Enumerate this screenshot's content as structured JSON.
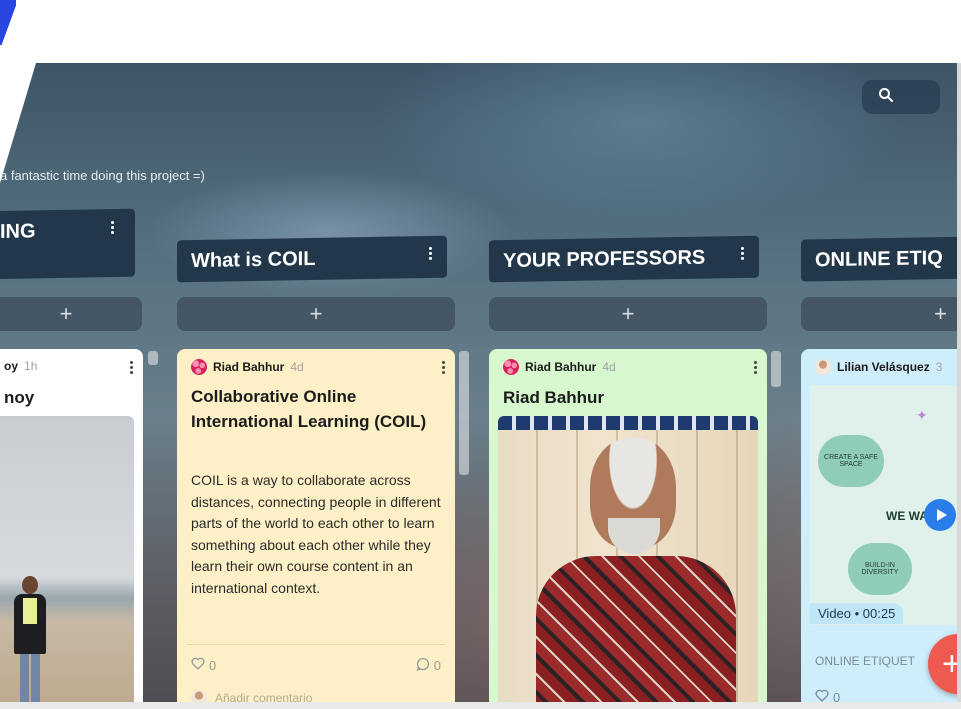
{
  "search": {
    "icon": "search-icon"
  },
  "board": {
    "subtitle": "a fantastic time doing this project =)"
  },
  "columns": [
    {
      "title": "ING",
      "add_label": "+",
      "card": {
        "author": "oy",
        "time": "1h",
        "title": "noy"
      }
    },
    {
      "title": "What is COIL",
      "add_label": "+",
      "card": {
        "author": "Riad Bahhur",
        "time": "4d",
        "title": "Collaborative Online International Learning (COIL)",
        "body": "COIL is a way to collaborate across distances, connecting people in different parts of the world to each other to learn something about each other while they learn their own course content in an international context.",
        "likes": "0",
        "comments": "0",
        "comment_placeholder": "Añadir comentario"
      }
    },
    {
      "title": "YOUR PROFESSORS",
      "add_label": "+",
      "card": {
        "author": "Riad Bahhur",
        "time": "4d",
        "title": "Riad Bahhur"
      }
    },
    {
      "title": "ONLINE ETIQ",
      "add_label": "+",
      "card": {
        "author": "Lilian Velásquez",
        "time": "3",
        "video_label": "Video • 00:25",
        "caption": "ONLINE ETIQUET",
        "likes": "0",
        "thumb_texts": {
          "bubble1": "CREATE A SAFE SPACE",
          "center": "WE WA",
          "bubble2": "BUILD-IN DIVERSITY"
        }
      }
    }
  ],
  "fab": {
    "label": "+"
  },
  "colors": {
    "header_bg": "#22384a",
    "card_yellow": "#fdf0c6",
    "card_green": "#d7f7cf",
    "card_blue": "#cfeefc",
    "fab": "#ee5a4f",
    "logo": "#2a46e0"
  }
}
